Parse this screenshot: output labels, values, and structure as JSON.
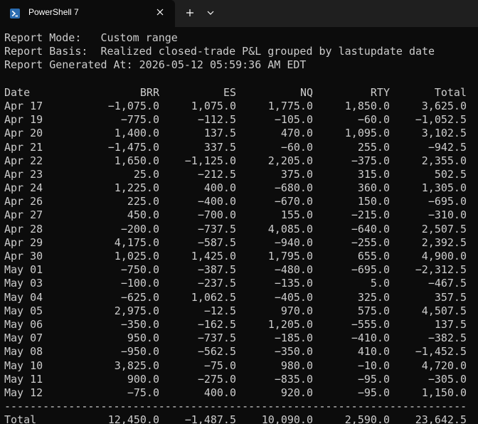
{
  "tab": {
    "title": "PowerShell 7",
    "icon": "powershell-icon"
  },
  "report": {
    "mode_line": "Report Mode:   Custom range",
    "basis_line": "Report Basis:  Realized closed-trade P&L grouped by lastupdate date",
    "generated_line": "Report Generated At: 2026-05-12 05:59:36 AM EDT"
  },
  "table": {
    "headers": [
      "Date",
      "BRR",
      "ES",
      "NQ",
      "RTY",
      "Total"
    ],
    "rows": [
      [
        "Apr 17",
        "−1,075.0",
        "1,075.0",
        "1,775.0",
        "1,850.0",
        "3,625.0"
      ],
      [
        "Apr 19",
        "−775.0",
        "−112.5",
        "−105.0",
        "−60.0",
        "−1,052.5"
      ],
      [
        "Apr 20",
        "1,400.0",
        "137.5",
        "470.0",
        "1,095.0",
        "3,102.5"
      ],
      [
        "Apr 21",
        "−1,475.0",
        "337.5",
        "−60.0",
        "255.0",
        "−942.5"
      ],
      [
        "Apr 22",
        "1,650.0",
        "−1,125.0",
        "2,205.0",
        "−375.0",
        "2,355.0"
      ],
      [
        "Apr 23",
        "25.0",
        "−212.5",
        "375.0",
        "315.0",
        "502.5"
      ],
      [
        "Apr 24",
        "1,225.0",
        "400.0",
        "−680.0",
        "360.0",
        "1,305.0"
      ],
      [
        "Apr 26",
        "225.0",
        "−400.0",
        "−670.0",
        "150.0",
        "−695.0"
      ],
      [
        "Apr 27",
        "450.0",
        "−700.0",
        "155.0",
        "−215.0",
        "−310.0"
      ],
      [
        "Apr 28",
        "−200.0",
        "−737.5",
        "4,085.0",
        "−640.0",
        "2,507.5"
      ],
      [
        "Apr 29",
        "4,175.0",
        "−587.5",
        "−940.0",
        "−255.0",
        "2,392.5"
      ],
      [
        "Apr 30",
        "1,025.0",
        "1,425.0",
        "1,795.0",
        "655.0",
        "4,900.0"
      ],
      [
        "May 01",
        "−750.0",
        "−387.5",
        "−480.0",
        "−695.0",
        "−2,312.5"
      ],
      [
        "May 03",
        "−100.0",
        "−237.5",
        "−135.0",
        "5.0",
        "−467.5"
      ],
      [
        "May 04",
        "−625.0",
        "1,062.5",
        "−405.0",
        "325.0",
        "357.5"
      ],
      [
        "May 05",
        "2,975.0",
        "−12.5",
        "970.0",
        "575.0",
        "4,507.5"
      ],
      [
        "May 06",
        "−350.0",
        "−162.5",
        "1,205.0",
        "−555.0",
        "137.5"
      ],
      [
        "May 07",
        "950.0",
        "−737.5",
        "−185.0",
        "−410.0",
        "−382.5"
      ],
      [
        "May 08",
        "−950.0",
        "−562.5",
        "−350.0",
        "410.0",
        "−1,452.5"
      ],
      [
        "May 10",
        "3,825.0",
        "−75.0",
        "980.0",
        "−10.0",
        "4,720.0"
      ],
      [
        "May 11",
        "900.0",
        "−275.0",
        "−835.0",
        "−95.0",
        "−305.0"
      ],
      [
        "May 12",
        "−75.0",
        "400.0",
        "920.0",
        "−95.0",
        "1,150.0"
      ]
    ],
    "separator": "------------------------------------------------------------------------------------------------",
    "total": [
      "Total",
      "12,450.0",
      "−1,487.5",
      "10,090.0",
      "2,590.0",
      "23,642.5"
    ]
  },
  "colors": {
    "background": "#0c0c0c",
    "titlebar": "#1f1f1f",
    "text": "#cccccc",
    "powershell_icon_bg": "#2b6cb0"
  }
}
